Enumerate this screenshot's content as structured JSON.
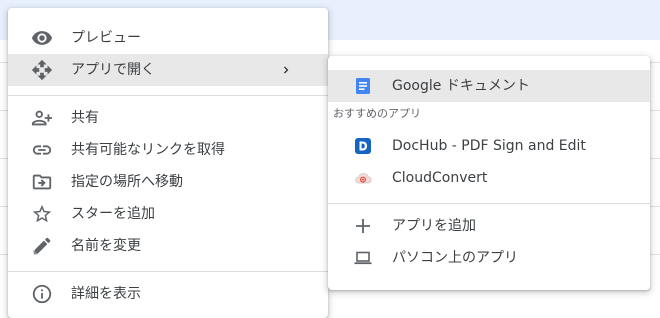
{
  "main_menu": {
    "items": [
      {
        "label": "プレビュー",
        "icon": "eye-icon"
      },
      {
        "label": "アプリで開く",
        "icon": "move-arrows-icon",
        "has_submenu": true
      },
      {
        "label": "共有",
        "icon": "person-add-icon"
      },
      {
        "label": "共有可能なリンクを取得",
        "icon": "link-icon"
      },
      {
        "label": "指定の場所へ移動",
        "icon": "folder-move-icon"
      },
      {
        "label": "スターを追加",
        "icon": "star-outline-icon"
      },
      {
        "label": "名前を変更",
        "icon": "pencil-icon"
      },
      {
        "label": "詳細を表示",
        "icon": "info-icon"
      }
    ]
  },
  "submenu": {
    "top_app": {
      "label": "Google ドキュメント",
      "icon": "google-docs-icon"
    },
    "section_label": "おすすめのアプリ",
    "suggested_apps": [
      {
        "label": "DocHub - PDF Sign and Edit",
        "icon": "dochub-icon"
      },
      {
        "label": "CloudConvert",
        "icon": "cloudconvert-icon"
      }
    ],
    "actions": [
      {
        "label": "アプリを追加",
        "icon": "plus-icon"
      },
      {
        "label": "パソコン上のアプリ",
        "icon": "laptop-icon"
      }
    ]
  },
  "colors": {
    "docs_blue": "#4285f4",
    "dochub_blue": "#1565c0",
    "cloudconvert_red": "#e34a36",
    "hover_bg": "#e8e8e8",
    "icon_gray": "#5f6368"
  }
}
